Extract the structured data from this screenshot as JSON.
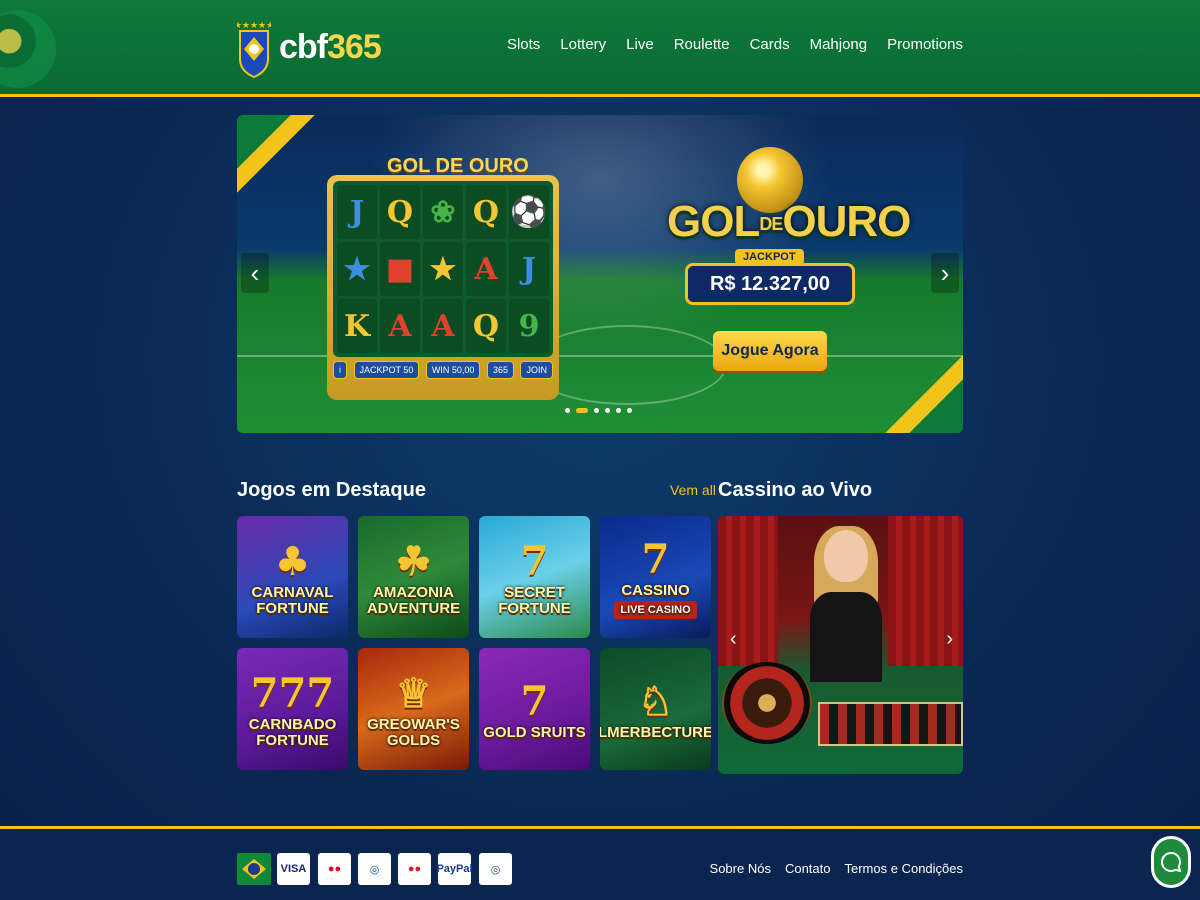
{
  "brand": {
    "logo_text_prefix": "cbf",
    "logo_text_suffix": "365",
    "accent": "#f2c31a",
    "primary_green": "#0e7a3a",
    "navy": "#0b2d5a"
  },
  "nav": {
    "items": [
      {
        "label": "Slots"
      },
      {
        "label": "Lottery"
      },
      {
        "label": "Live"
      },
      {
        "label": "Roulette"
      },
      {
        "label": "Cards"
      },
      {
        "label": "Mahjong"
      },
      {
        "label": "Promotions"
      }
    ]
  },
  "hero": {
    "slot_title": "GOL DE OURO",
    "slot_symbols": [
      {
        "t": "J",
        "c": "blue"
      },
      {
        "t": "Q",
        "c": "gold"
      },
      {
        "t": "❀",
        "c": "green"
      },
      {
        "t": "Q",
        "c": "gold"
      },
      {
        "t": "⚽",
        "c": "gold"
      },
      {
        "t": "★",
        "c": "blue"
      },
      {
        "t": "■",
        "c": "red"
      },
      {
        "t": "★",
        "c": "gold"
      },
      {
        "t": "A",
        "c": "red"
      },
      {
        "t": "J",
        "c": "blue"
      },
      {
        "t": "K",
        "c": "gold"
      },
      {
        "t": "A",
        "c": "red"
      },
      {
        "t": "A",
        "c": "red"
      },
      {
        "t": "Q",
        "c": "gold"
      },
      {
        "t": "9",
        "c": "green"
      }
    ],
    "slot_controls": {
      "jackpot": "JACKPOT 50",
      "win": "WIN 50,00",
      "bet": "365",
      "spin": "JOIN"
    },
    "title_part1": "GOL",
    "title_part2": "DE",
    "title_part3": "OURO",
    "jackpot_label": "JACKPOT",
    "jackpot_amount": "R$ 12.327,00",
    "cta_label": "Jogue Agora",
    "slides": 6,
    "active_slide": 2
  },
  "featured": {
    "title": "Jogos em Destaque",
    "see_all": "Vem all",
    "games": [
      {
        "emblem": "♣",
        "title": "CARNAVAL FORTUNE",
        "bg": "linear-gradient(160deg,#6a2aa8,#2a4ab8 60%,#0a2a6a)"
      },
      {
        "emblem": "☘",
        "title": "AMAZONIA ADVENTURE",
        "bg": "linear-gradient(160deg,#1a6a2a,#2f8a3a 50%,#0d4a1a)"
      },
      {
        "emblem": "7",
        "title": "SECRET FORTUNE",
        "bg": "linear-gradient(160deg,#2aa8d8,#6ad0e8 50%,#2a8a4a)"
      },
      {
        "emblem": "7",
        "title": "CASSINO",
        "subtitle": "LIVE CASINO",
        "bg": "linear-gradient(160deg,#0a2a8a,#1a4ab8 60%,#0a1a5a)"
      },
      {
        "emblem": "777",
        "title": "CARNBADO FORTUNE",
        "bg": "linear-gradient(160deg,#7a2ab8,#5a1a9a 60%,#3a0a6a)"
      },
      {
        "emblem": "♕",
        "title": "GREOWAR'S GOLDS",
        "bg": "linear-gradient(160deg,#a8280e,#d86a1a 50%,#7a1a0a)"
      },
      {
        "emblem": "7",
        "title": "GOLD SRUITS",
        "bg": "linear-gradient(160deg,#8a2ab8,#6a1a9a 60%,#4a0a7a)"
      },
      {
        "emblem": "♘",
        "title": "LMERBECTURE",
        "bg": "linear-gradient(160deg,#0d4a2a,#1a6a3a 60%,#0a3a1e)"
      }
    ]
  },
  "live": {
    "title": "Cassino ao Vivo"
  },
  "footer": {
    "payments": [
      {
        "label": "VISA",
        "color": "#1a1f71"
      },
      {
        "label": "●●",
        "color": "#eb001b"
      },
      {
        "label": "◎",
        "color": "#0a5aa8"
      },
      {
        "label": "●●",
        "color": "#d81a2a"
      },
      {
        "label": "PayPal",
        "color": "#1a3a8a"
      },
      {
        "label": "◎",
        "color": "#2a4a7a"
      }
    ],
    "links": [
      {
        "label": "Sobre Nós"
      },
      {
        "label": "Contato"
      },
      {
        "label": "Termos e Condições"
      }
    ]
  }
}
